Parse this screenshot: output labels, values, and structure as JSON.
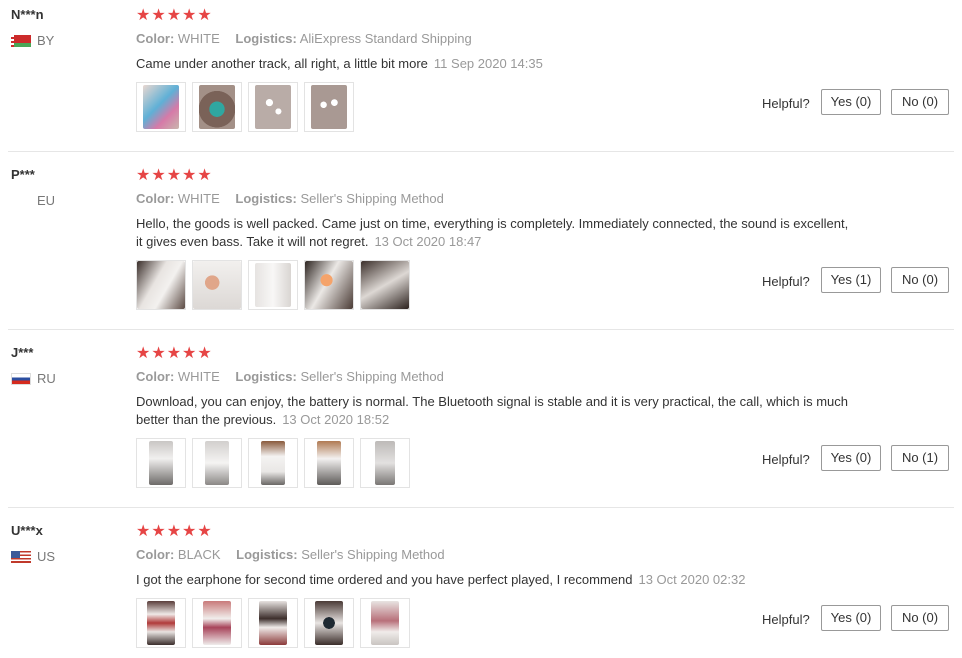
{
  "labels": {
    "color": "Color:",
    "logistics": "Logistics:",
    "helpful": "Helpful?"
  },
  "star_glyphs": "★★★★★",
  "reviews": [
    {
      "user": "N***n",
      "country": "BY",
      "flag": "by",
      "rating": 5,
      "color": "WHITE",
      "logistics": "AliExpress Standard Shipping",
      "text": "Came under another track, all right, a little bit more",
      "date": "11 Sep 2020 14:35",
      "photos": [
        "blue-pink-package-photo",
        "turquoise-box-photo",
        "white-parts-on-cloth-photo",
        "white-earbuds-photo"
      ],
      "yes": "Yes (0)",
      "no": "No (0)"
    },
    {
      "user": "P***",
      "country": "EU",
      "flag": "",
      "rating": 5,
      "color": "WHITE",
      "logistics": "Seller's Shipping Method",
      "text": "Hello, the goods is well packed. Came just on time, everything is completely. Immediately connected, the sound is excellent, it gives even bass. Take it will not regret.",
      "date": "13 Oct 2020 18:47",
      "photos": [
        "phone-box-photo",
        "phone-with-case-photo",
        "white-box-photo",
        "phone-box-side-photo",
        "phone-screen-photo"
      ],
      "yes": "Yes (1)",
      "no": "No (0)"
    },
    {
      "user": "J***",
      "country": "RU",
      "flag": "ru",
      "rating": 5,
      "color": "WHITE",
      "logistics": "Seller's Shipping Method",
      "text": "Download, you can enjoy, the battery is normal. The Bluetooth signal is stable and it is very practical, the call, which is much better than the previous.",
      "date": "13 Oct 2020 18:52",
      "photos": [
        "earbud-case-hand-photo",
        "earbud-case-open-photo",
        "earbuds-in-case-photo",
        "case-front-photo",
        "case-back-photo"
      ],
      "yes": "Yes (0)",
      "no": "No (1)"
    },
    {
      "user": "U***x",
      "country": "US",
      "flag": "us",
      "rating": 5,
      "color": "BLACK",
      "logistics": "Seller's Shipping Method",
      "text": "I got the earphone for second time ordered and you have perfect played, I recommend",
      "date": "13 Oct 2020 02:32",
      "photos": [
        "product-box-photo",
        "box-contents-photo",
        "box-open-photo",
        "black-earbuds-photo",
        "box-side-photo"
      ],
      "yes": "Yes (0)",
      "no": "No (0)"
    }
  ]
}
